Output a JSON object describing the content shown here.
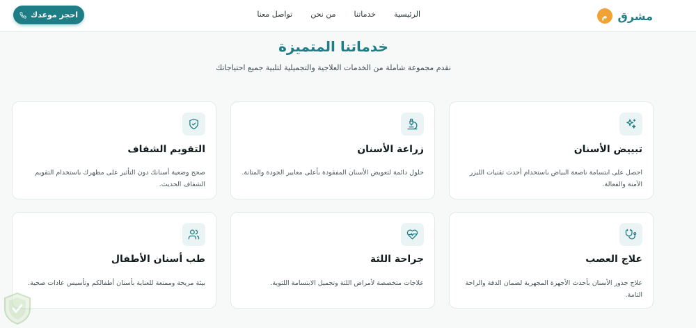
{
  "header": {
    "brand_initial": "م",
    "brand_name": "مشرق",
    "nav": [
      "الرئيسية",
      "خدماتنا",
      "من نحن",
      "تواصل معنا"
    ],
    "cta_label": "احجز موعدك"
  },
  "section": {
    "title": "خدماتنا المتميزة",
    "subtitle": "نقدم مجموعة شاملة من الخدمات العلاجية والتجميلية لتلبية جميع احتياجاتك"
  },
  "services": [
    {
      "icon": "sparkles-icon",
      "title": "تبييض الأسنان",
      "desc": "احصل على ابتسامة ناصعة البياض باستخدام أحدث تقنيات الليزر الآمنة والفعالة."
    },
    {
      "icon": "microscope-icon",
      "title": "زراعة الأسنان",
      "desc": "حلول دائمة لتعويض الأسنان المفقودة بأعلى معايير الجودة والمتانة."
    },
    {
      "icon": "shield-check-icon",
      "title": "التقويم الشفاف",
      "desc": "صحح وضعية أسنانك دون التأثير على مظهرك باستخدام التقويم الشفاف الحديث."
    },
    {
      "icon": "stethoscope-icon",
      "title": "علاج العصب",
      "desc": "علاج جذور الأسنان بأحدث الأجهزة المجهرية لضمان الدقة والراحة التامة."
    },
    {
      "icon": "heart-pulse-icon",
      "title": "جراحة اللثة",
      "desc": "علاجات متخصصة لأمراض اللثة وتجميل الابتسامة اللثوية."
    },
    {
      "icon": "users-icon",
      "title": "طب أسنان الأطفال",
      "desc": "بيئة مريحة وممتعة للعناية بأسنان أطفالكم وتأسيس عادات صحية."
    }
  ],
  "colors": {
    "primary": "#1f7d86",
    "accent": "#f2a233",
    "icon_bg": "#eaf4f4"
  }
}
